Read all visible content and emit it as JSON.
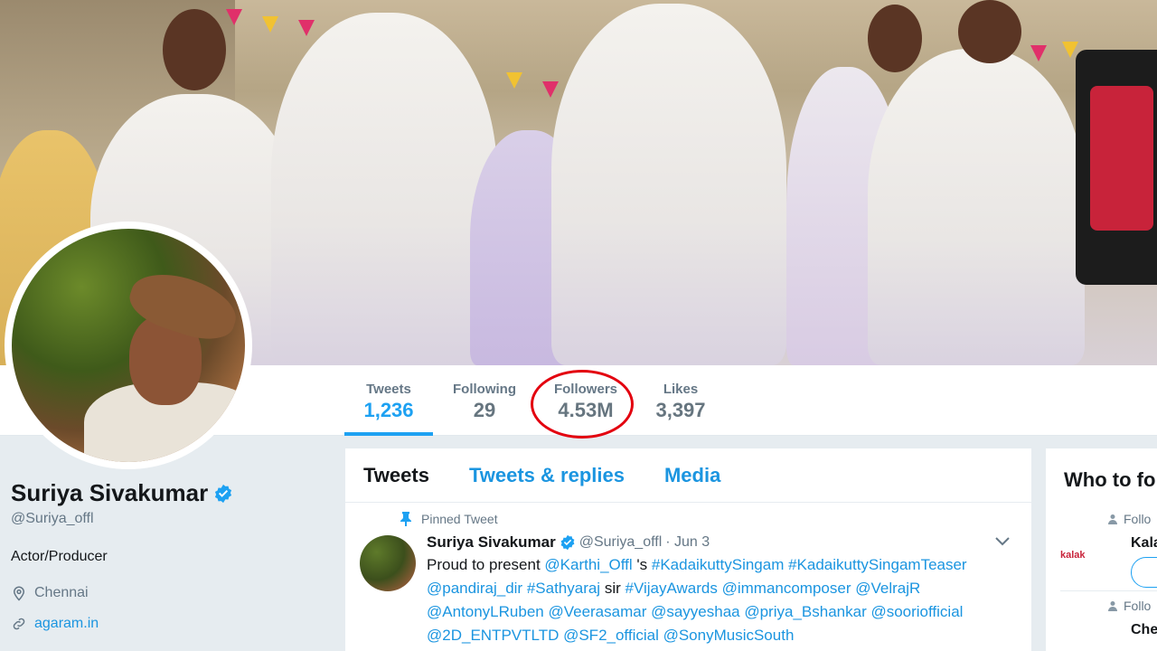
{
  "stats": [
    {
      "label": "Tweets",
      "value": "1,236"
    },
    {
      "label": "Following",
      "value": "29"
    },
    {
      "label": "Followers",
      "value": "4.53M"
    },
    {
      "label": "Likes",
      "value": "3,397"
    }
  ],
  "profile": {
    "name": "Suriya Sivakumar",
    "handle": "@Suriya_offl",
    "bio": "Actor/Producer",
    "location": "Chennai",
    "website": "agaram.in"
  },
  "timeline": {
    "tabs": [
      "Tweets",
      "Tweets & replies",
      "Media"
    ],
    "pinned_label": "Pinned Tweet",
    "tweet": {
      "name": "Suriya Sivakumar",
      "handle": "@Suriya_offl",
      "date": "· Jun 3",
      "line1_pre": "Proud to present ",
      "line1_mention": "@Karthi_Offl",
      "line1_mid": " 's ",
      "line1_tags": "#KadaikuttySingam #KadaikuttySingamTeaser",
      "line2_a": "@pandiraj_dir #Sathyaraj",
      "line2_b": " sir ",
      "line2_c": "#VijayAwards @immancomposer @VelrajR",
      "line3": "@AntonyLRuben @Veerasamar @sayyeshaa @priya_Bshankar @sooriofficial",
      "line4": "@2D_ENTPVTLTD @SF2_official @SonyMusicSouth"
    }
  },
  "who_to_follow": {
    "title": "Who to fo",
    "items": [
      {
        "label": "Follo",
        "name": "Kala",
        "logo_text": "kalak"
      },
      {
        "label": "Follo",
        "name": "Che"
      }
    ]
  },
  "colors": {
    "accent": "#1da1f2",
    "link": "#1b95e0",
    "highlight_circle": "#e3000f"
  }
}
